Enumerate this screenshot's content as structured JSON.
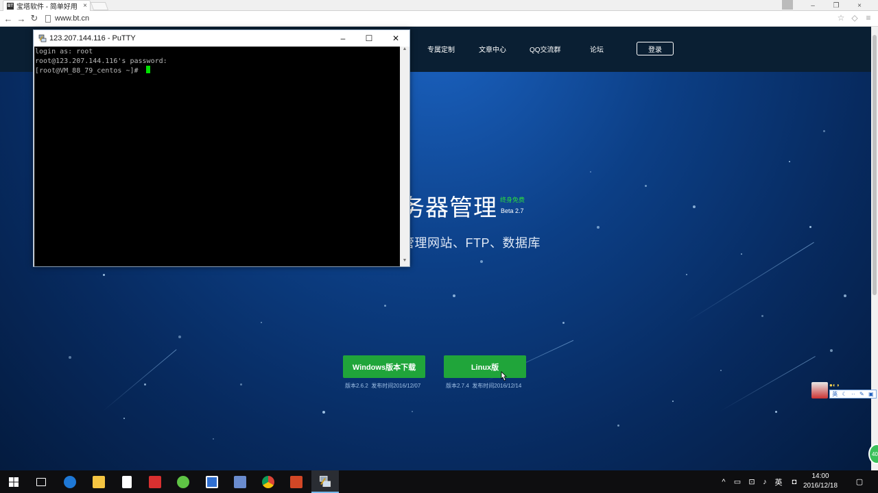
{
  "browser": {
    "tab_title": "宝塔软件 - 简单好用",
    "favicon_text": "BT",
    "url": "www.bt.cn"
  },
  "site": {
    "nav": [
      "专属定制",
      "文章中心",
      "QQ交流群",
      "论坛"
    ],
    "login": "登录",
    "hero_title": "务器管理",
    "badge": "终身免费",
    "beta": "Beta 2.7",
    "hero_sub": "管理网站、FTP、数据库",
    "windows_btn": "Windows版本下载",
    "windows_version": "版本2.6.2",
    "windows_date": "发布时间2016/12/07",
    "linux_btn": "Linux版",
    "linux_version": "版本2.7.4",
    "linux_date": "发布时间2016/12/14"
  },
  "putty": {
    "title": "123.207.144.116 - PuTTY",
    "lines": [
      "login as: root",
      "root@123.207.144.116's password:",
      "[root@VM_88_79_centos ~]# "
    ]
  },
  "ime": {
    "lang": "英",
    "float_badge": "40"
  },
  "taskbar": {
    "ime_lang": "英",
    "time": "14:00",
    "date": "2016/12/18"
  },
  "colors": {
    "accent_green": "#20a53a",
    "terminal_cursor": "#00e000",
    "site_nav_bg": "#0a1f33"
  }
}
